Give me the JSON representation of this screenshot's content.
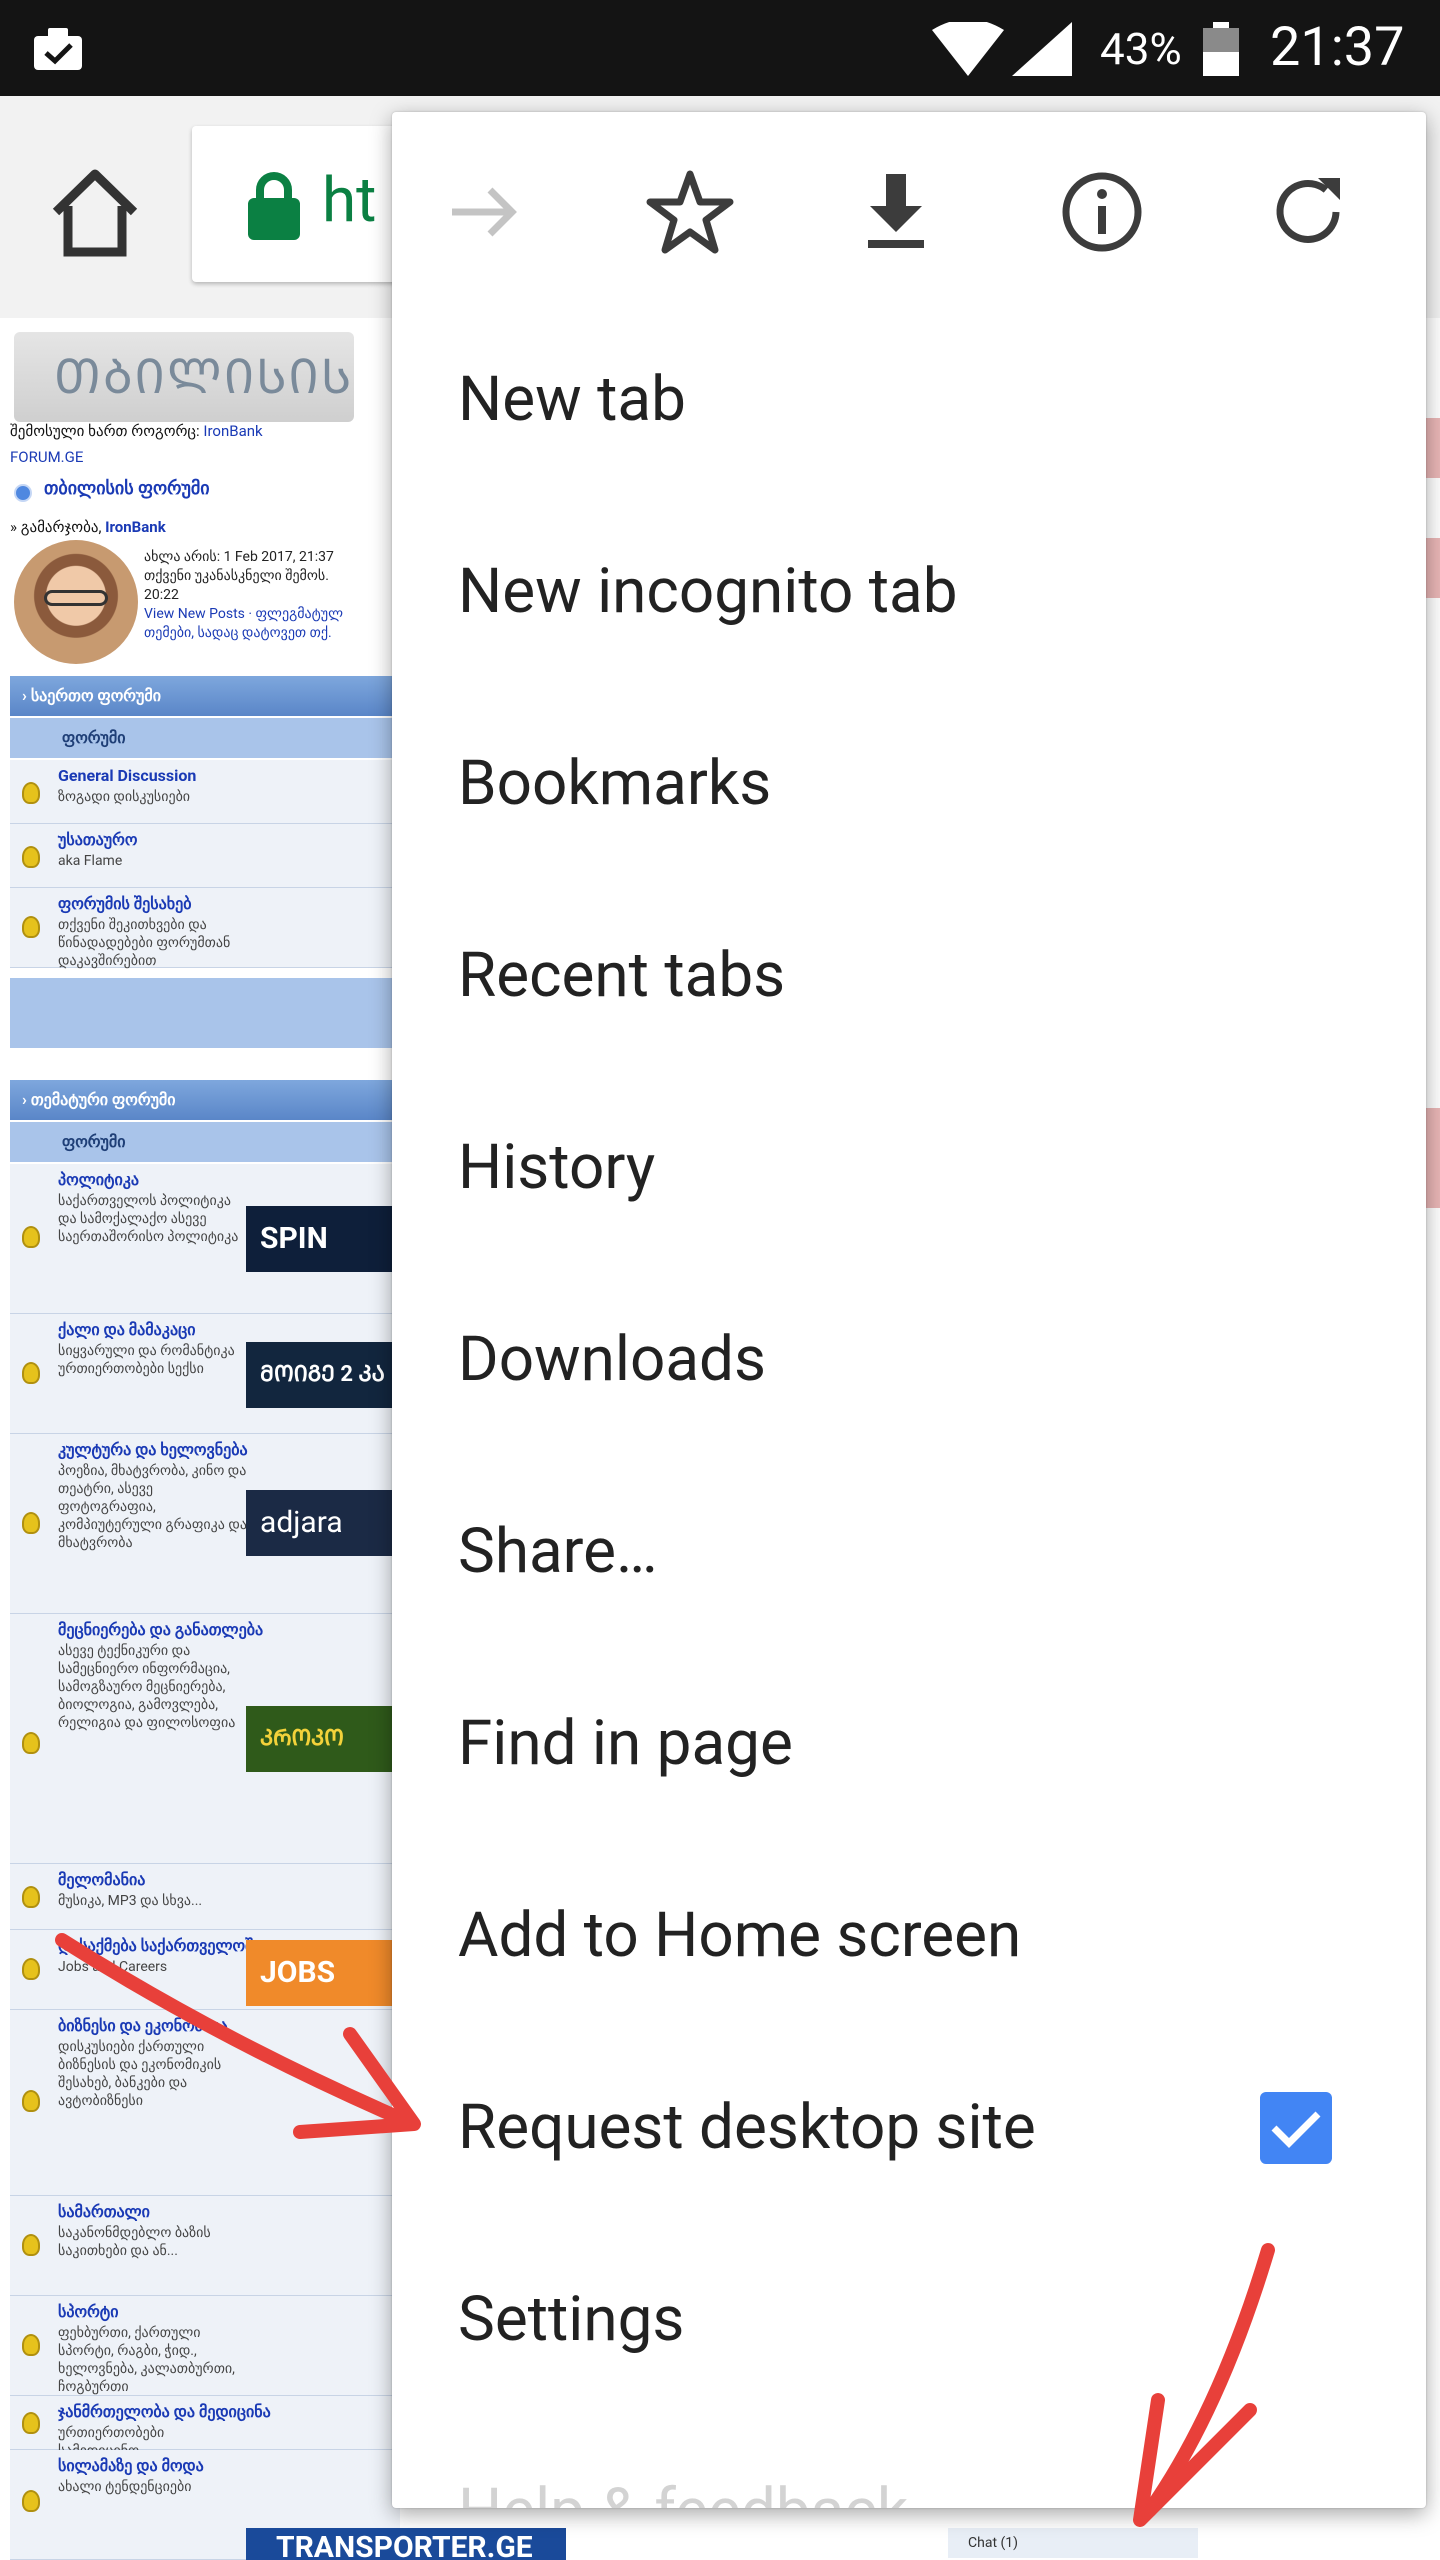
{
  "status_bar": {
    "battery_percent": "43%",
    "time": "21:37"
  },
  "toolbar": {
    "url_fragment": "ht"
  },
  "webpage": {
    "logged_in_label": "შემოსული ხართ როგორც:",
    "username": "IronBank",
    "site_link": "FORUM.GE",
    "board_name": "თბილისის ფორუმი",
    "breadcrumb_prefix": "» გამარჯობა,",
    "info_lines": [
      "ახლა არის: 1 Feb 2017, 21:37",
      "თქვენი უკანასკნელი შემოს.",
      "20:22",
      "View New Posts · ფლეგმატულ",
      "თემები, სადაც დატოვეთ თქ."
    ],
    "categories": [
      {
        "header": "› საერთო ფორუმი",
        "column": "ფორუმი",
        "rows": [
          {
            "title": "General Discussion",
            "desc": "ზოგადი დისკუსიები"
          },
          {
            "title": "უსათაურო",
            "desc": "aka Flame"
          },
          {
            "title": "ფორუმის შესახებ",
            "desc": "თქვენი შეკითხვები და წინადადებები ფორუმთან დაკავშირებით"
          }
        ]
      },
      {
        "header": "› თემატური ფორუმი",
        "column": "ფორუმი",
        "rows": [
          {
            "title": "პოლიტიკა",
            "desc": "საქართველოს პოლიტიკა და სამოქალაქო ასევე საერთაშორისო პოლიტიკა",
            "banner": "SPIN"
          },
          {
            "title": "ქალი და მამაკაცი",
            "desc": "სიყვარული და რომანტიკა ურთიერთობები სექსი",
            "banner": "ᲛᲝᲘᲒᲔ 2 ᲙᲐ"
          },
          {
            "title": "კულტურა და ხელოვნება",
            "desc": "პოეზია, მხატვრობა, კინო და თეატრი, ასევე ფოტოგრაფია, კომპიუტერული გრაფიკა და მხატვრობა",
            "banner": "adjara"
          },
          {
            "title": "მეცნიერება და განათლება",
            "desc": "ასევე ტექნიკური და სამეცნიერო ინფორმაცია, სამოგზაურო მეცნიერება, ბიოლოგია, გამოვლება, რელიგია და ფილოსოფია",
            "banner": "ᲙᲠᲝᲙᲝ"
          },
          {
            "title": "მელომანია",
            "desc": "მუსიკა, MP3 და სხვა..."
          },
          {
            "title": "დასაქმება საქართველოში",
            "desc": "Jobs and Careers",
            "banner": "JOBS"
          },
          {
            "title": "ბიზნესი და ეკონომიკა",
            "desc": "დისკუსიები ქართული ბიზნესის და ეკონომიკის შესახებ, ბანკები და ავტობიზნესი"
          },
          {
            "title": "სამართალი",
            "desc": "საკანონმდებლო ბაზის საკითხები და ან..."
          },
          {
            "title": "სპორტი",
            "desc": "ფეხბურთი, ქართული სპორტი, რაგბი, ჭიდ., ხელოვნება, კალათბურთი, ჩოგბურთი"
          },
          {
            "title": "ჯანმრთელობა და მედიცინა",
            "desc": "ურთიერთობები სამედიცინო ..."
          },
          {
            "title": "სილამაზე და მოდა",
            "desc": "ახალი ტენდენციები",
            "banner": "TRANSPORTER.GE"
          }
        ]
      }
    ],
    "chat_label": "Chat (1)"
  },
  "menu": {
    "icon_row": [
      "forward-icon",
      "bookmark-star-icon",
      "download-icon",
      "page-info-icon",
      "reload-icon"
    ],
    "items": [
      {
        "label": "New tab"
      },
      {
        "label": "New incognito tab"
      },
      {
        "label": "Bookmarks"
      },
      {
        "label": "Recent tabs"
      },
      {
        "label": "History"
      },
      {
        "label": "Downloads"
      },
      {
        "label": "Share…"
      },
      {
        "label": "Find in page"
      },
      {
        "label": "Add to Home screen"
      },
      {
        "label": "Request desktop site",
        "checked": true
      },
      {
        "label": "Settings"
      },
      {
        "label": "Help & feedback"
      }
    ]
  },
  "colors": {
    "accent": "#4285f4",
    "annotation_red": "#e8403a",
    "secure_green": "#0b8043"
  }
}
